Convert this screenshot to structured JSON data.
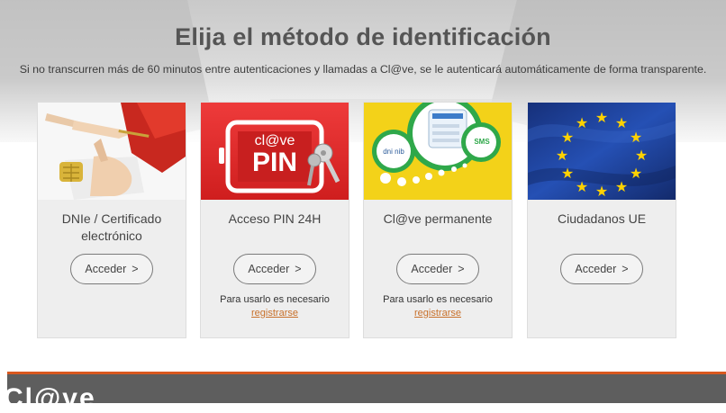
{
  "page": {
    "title": "Elija el método de identificación",
    "subtitle": "Si no transcurren más de 60 minutos entre autenticaciones y llamadas a Cl@ve, se le autenticará automáticamente de forma transparente."
  },
  "cards": [
    {
      "name": "DNIe / Certificado electrónico",
      "button": "Acceder",
      "chevron": ">",
      "image": "dnie-hand-chip-card-image"
    },
    {
      "name": "Acceso PIN 24H",
      "button": "Acceder",
      "chevron": ">",
      "note": "Para usarlo es necesario",
      "link": "registrarse",
      "image": "clave-pin-phone-image",
      "image_text": {
        "line1": "cl@ve",
        "line2": "PIN"
      }
    },
    {
      "name": "Cl@ve permanente",
      "button": "Acceder",
      "chevron": ">",
      "note": "Para usarlo es necesario",
      "link": "registrarse",
      "image": "clave-permanente-bubbles-image",
      "image_text": {
        "sms": "SMS",
        "left": "dni nib"
      }
    },
    {
      "name": "Ciudadanos UE",
      "button": "Acceder",
      "chevron": ">",
      "image": "eu-flag-image"
    }
  ],
  "footer": {
    "logo": "Cl@ve"
  },
  "colors": {
    "link": "#c8702a",
    "footer_bg": "#5e5e5e",
    "footer_accent": "#d9581f",
    "pin_red": "#e02525",
    "permanente_yellow": "#f3d219",
    "eu_blue": "#1d3d8f",
    "eu_star": "#ffd200"
  }
}
